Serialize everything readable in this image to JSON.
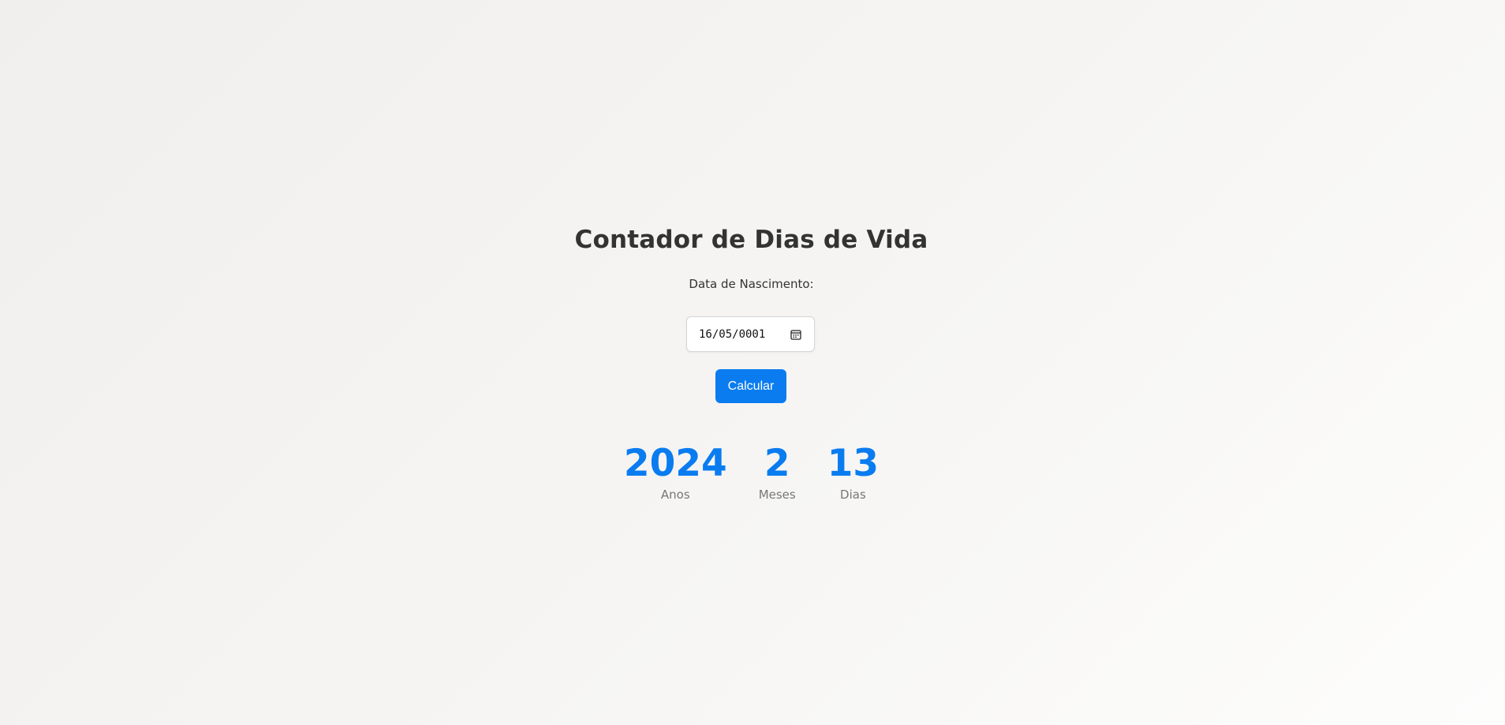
{
  "title": "Contador de Dias de Vida",
  "form": {
    "birth_label": "Data de Nascimento:",
    "birth_value": "16/05/0001",
    "calendar_icon": "calendar-icon",
    "calculate_label": "Calcular"
  },
  "results": {
    "years_value": "2024",
    "years_label": "Anos",
    "months_value": "2",
    "months_label": "Meses",
    "days_value": "13",
    "days_label": "Dias"
  },
  "colors": {
    "accent": "#0a7cf0",
    "text": "#333333",
    "muted": "#777777"
  }
}
